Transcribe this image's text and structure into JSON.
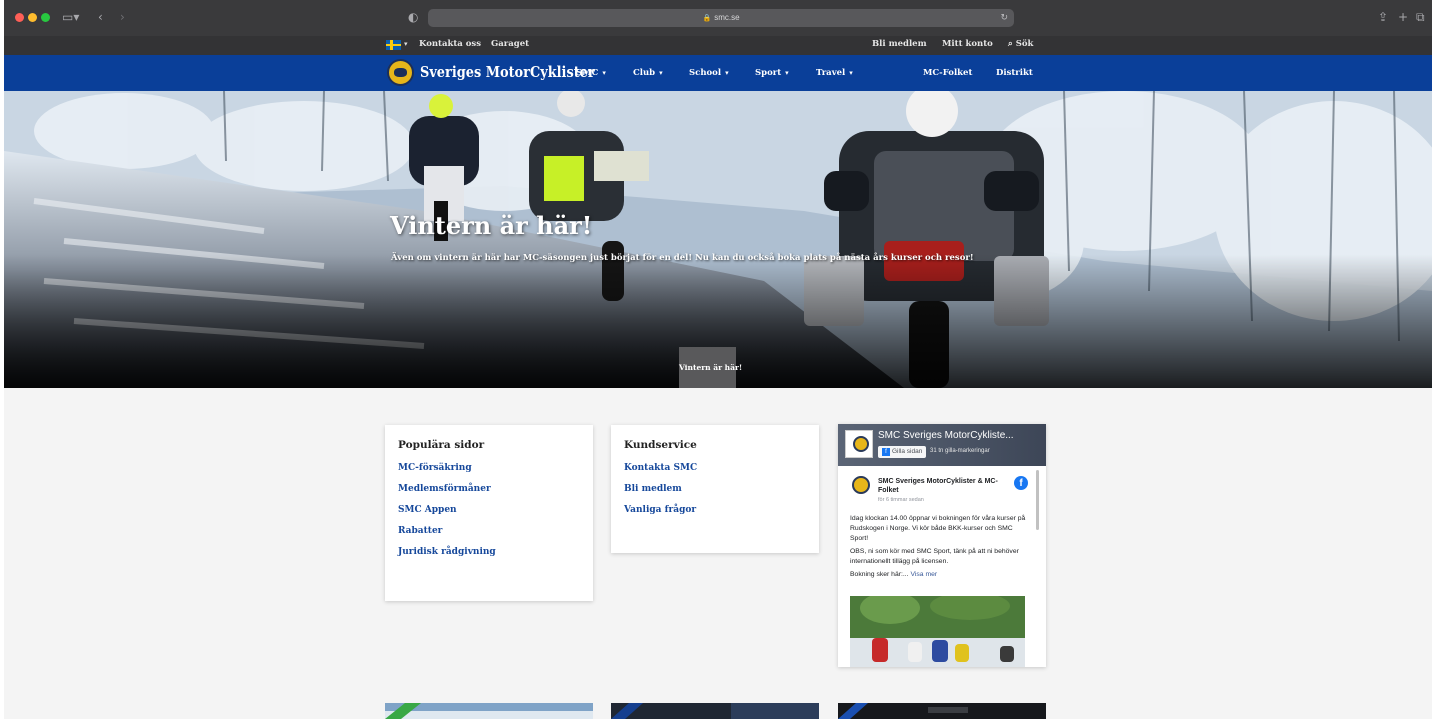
{
  "browser": {
    "url": "smc.se"
  },
  "topbar": {
    "left_links": [
      "Kontakta oss",
      "Garaget"
    ],
    "right_links": [
      "Bli medlem",
      "Mitt konto"
    ],
    "search_label": "Sök"
  },
  "nav": {
    "brand": "Sveriges MotorCyklister",
    "menu": [
      {
        "label": "SMC",
        "dropdown": true
      },
      {
        "label": "Club",
        "dropdown": true
      },
      {
        "label": "School",
        "dropdown": true
      },
      {
        "label": "Sport",
        "dropdown": true
      },
      {
        "label": "Travel",
        "dropdown": true
      }
    ],
    "right_menu": [
      "MC-Folket",
      "Distrikt"
    ]
  },
  "hero": {
    "title": "Vintern är här!",
    "subtitle": "Även om vintern är här har MC-säsongen just börjat för en del! Nu kan du också boka plats på nästa års kurser och resor!",
    "button": "Vintern är här!"
  },
  "popular": {
    "heading": "Populära sidor",
    "links": [
      "MC-försäkring",
      "Medlemsförmåner",
      "SMC Appen",
      "Rabatter",
      "Juridisk rådgivning"
    ]
  },
  "service": {
    "heading": "Kundservice",
    "links": [
      "Kontakta SMC",
      "Bli medlem",
      "Vanliga frågor"
    ]
  },
  "facebook": {
    "page_name": "SMC Sveriges MotorCykliste...",
    "like_button": "Gilla sidan",
    "likes_text": "31 tn gilla-markeringar",
    "post_author": "SMC Sveriges MotorCyklister & MC-Folket",
    "post_time": "för 6 timmar sedan",
    "post_p1": "Idag klockan 14.00 öppnar vi bokningen för våra kurser på Rudskogen i Norge. Vi kör både BKK-kurser och SMC Sport!",
    "post_p2": "OBS, ni som kör med SMC Sport, tänk på att ni behöver internationellt tillägg på licensen.",
    "post_p3": "Bokning sker här:...",
    "see_more": "Visa mer"
  },
  "colors": {
    "nav_blue": "#0a3f99",
    "link_blue": "#16489b",
    "topbar_dark": "#333335",
    "accent_yellow": "#e7b61a"
  }
}
